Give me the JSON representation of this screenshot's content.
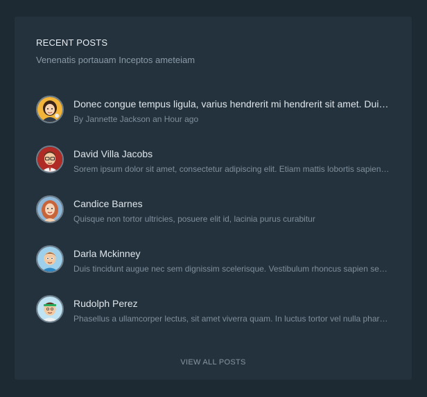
{
  "widget": {
    "title": "RECENT POSTS",
    "subtitle": "Venenatis portauam Inceptos ameteiam",
    "view_all_label": "VIEW ALL POSTS"
  },
  "posts": [
    {
      "avatar": "woman-dark-hair-avatar-icon",
      "title": "Donec congue tempus ligula, varius hendrerit mi hendrerit sit amet. Duis ac quam sit amet leo feugiat iaculis.",
      "subtitle": "By Jannette Jackson an Hour ago"
    },
    {
      "avatar": "man-glasses-avatar-icon",
      "title": "David Villa Jacobs",
      "subtitle": "Sorem ipsum dolor sit amet, consectetur adipiscing elit. Etiam mattis lobortis sapien non posuere."
    },
    {
      "avatar": "woman-red-hair-avatar-icon",
      "title": "Candice Barnes",
      "subtitle": "Quisque non tortor ultricies, posuere elit id, lacinia purus curabitur"
    },
    {
      "avatar": "boy-brown-hair-avatar-icon",
      "title": "Darla Mckinney",
      "subtitle": "Duis tincidunt augue nec sem dignissim scelerisque. Vestibulum rhoncus sapien sed nulla aliquam."
    },
    {
      "avatar": "boy-headband-avatar-icon",
      "title": "Rudolph Perez",
      "subtitle": "Phasellus a ullamcorper lectus, sit amet viverra quam. In luctus tortor vel nulla pharetra bibendum."
    }
  ]
}
